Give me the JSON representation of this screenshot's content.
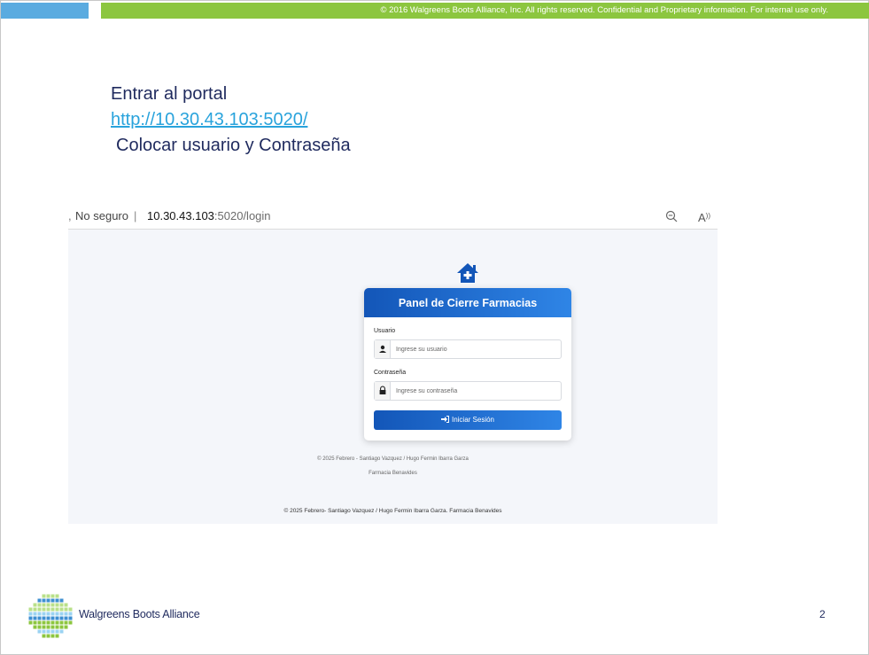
{
  "header": {
    "copyright": "© 2016 Walgreens Boots Alliance, Inc. All rights reserved. Confidential and Proprietary information. For internal use only.",
    "colors": {
      "blue": "#5aabe0",
      "green": "#8cc63f"
    }
  },
  "intro": {
    "line1": "Entrar al portal",
    "link": "http://10.30.43.103:5020/",
    "line3": "Colocar  usuario y Contraseña"
  },
  "browser": {
    "security_label": "No seguro",
    "url_host": "10.30.43.103",
    "url_path": ":5020/login",
    "read_aloud": "A))"
  },
  "login": {
    "title": "Panel de Cierre Farmacias",
    "username_label": "Usuario",
    "username_placeholder": "Ingrese su usuario",
    "password_label": "Contraseña",
    "password_placeholder": "Ingrese su contraseña",
    "submit_label": "Iniciar Sesión",
    "footer_line1": "© 2025 Febrero - Santiago Vazquez / Hugo Fermin Ibarra Garza",
    "footer_line2": "Farmacia Benavides",
    "page_footer": "© 2025 Febrero- Santiago Vazquez / Hugo Fermin Ibarra Garza. Farmacia Benavides",
    "accent_color": "#1356b8"
  },
  "footer": {
    "brand": "Walgreens Boots Alliance",
    "page_number": "2"
  }
}
